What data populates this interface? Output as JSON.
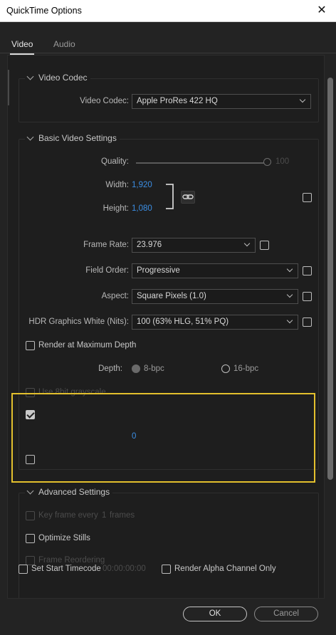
{
  "window": {
    "title": "QuickTime Options",
    "close_glyph": "✕"
  },
  "tabs": [
    {
      "label": "Video",
      "active": true
    },
    {
      "label": "Audio",
      "active": false
    }
  ],
  "video_codec_section": {
    "title": "Video Codec",
    "codec_label": "Video Codec:",
    "codec_value": "Apple ProRes 422 HQ"
  },
  "basic_section": {
    "title": "Basic Video Settings",
    "quality_label": "Quality:",
    "quality_value": "100",
    "width_label": "Width:",
    "width_value": "1,920",
    "height_label": "Height:",
    "height_value": "1,080",
    "frame_rate_label": "Frame Rate:",
    "frame_rate_value": "23.976",
    "field_order_label": "Field Order:",
    "field_order_value": "Progressive",
    "aspect_label": "Aspect:",
    "aspect_value": "Square Pixels (1.0)",
    "hdr_label": "HDR Graphics White (Nits):",
    "hdr_value": "100 (63% HLG, 51% PQ)",
    "render_max_depth_label": "Render at Maximum Depth",
    "depth_label": "Depth:",
    "depth_8": "8-bpc",
    "depth_16": "16-bpc",
    "grayscale_label": "Use 8bit grayscale",
    "highlight_value": "0"
  },
  "advanced_section": {
    "title": "Advanced Settings",
    "keyframe_label": "Key frame every",
    "keyframe_value": "1",
    "keyframe_unit": "frames",
    "optimize_stills_label": "Optimize Stills",
    "frame_reordering_label": "Frame Reordering",
    "set_start_timecode_label": "Set Start Timecode",
    "timecode_value": "00:00:00:00",
    "render_alpha_label": "Render Alpha Channel Only"
  },
  "footer": {
    "ok_label": "OK",
    "cancel_label": "Cancel"
  },
  "colors": {
    "accent_blue": "#3b8ee4",
    "highlight_yellow": "#e3c02d"
  }
}
